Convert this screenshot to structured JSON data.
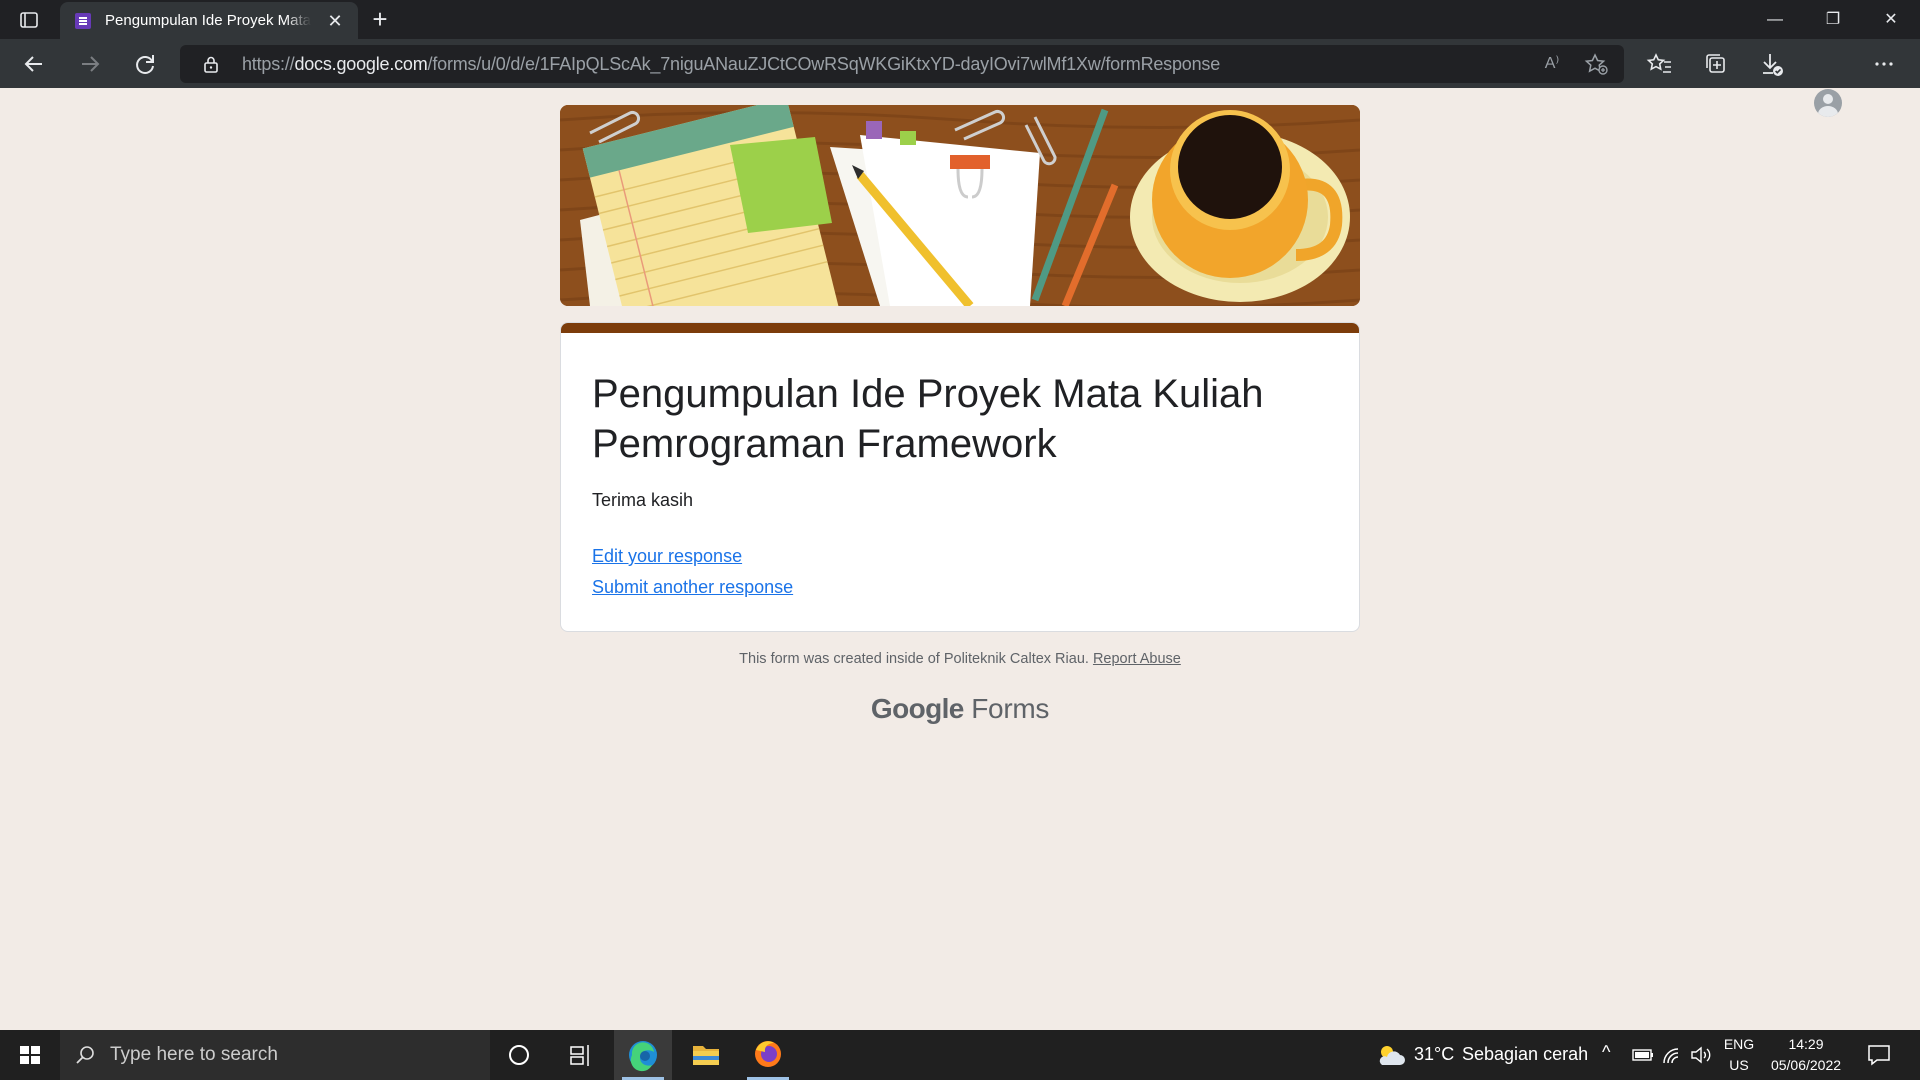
{
  "browser": {
    "tab_title": "Pengumpulan Ide Proyek Mata Kuliah Pemrograman Framework",
    "url_prefix": "https://",
    "url_host": "docs.google.com",
    "url_path": "/forms/u/0/d/e/1FAIpQLScAk_7niguANauZJCtCOwRSqWKGiKtxYD-dayIOvi7wlMf1Xw/formResponse",
    "read_aloud_icon_text": "A⁾",
    "window_controls": {
      "minimize": "—",
      "restore": "❐",
      "close": "✕"
    }
  },
  "form": {
    "title": "Pengumpulan Ide Proyek Mata Kuliah Pemrograman Framework",
    "confirmation": "Terima kasih",
    "edit_link": "Edit your response",
    "submit_another_link": "Submit another response",
    "footer_text": "This form was created inside of Politeknik Caltex Riau.",
    "report_abuse": "Report Abuse",
    "brand_google": "Google",
    "brand_forms": "Forms",
    "theme_color": "#7c3c0b",
    "background_color": "#f2ebe6"
  },
  "taskbar": {
    "search_placeholder": "Type here to search",
    "weather_temp": "31°C",
    "weather_desc": "Sebagian cerah",
    "lang_primary": "ENG",
    "lang_secondary": "US",
    "time": "14:29",
    "date": "05/06/2022"
  }
}
